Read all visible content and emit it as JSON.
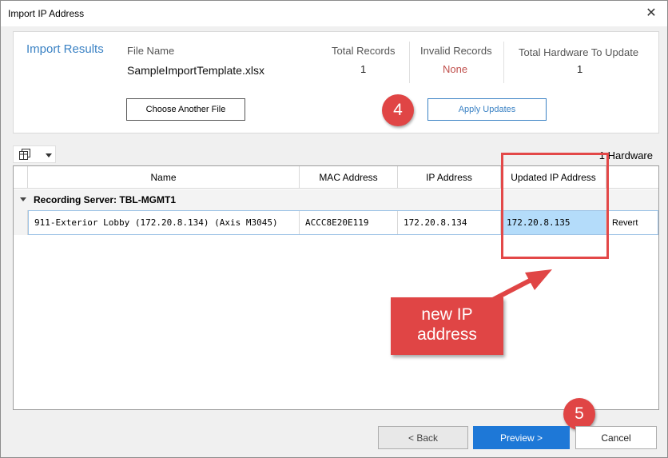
{
  "window": {
    "title": "Import IP Address",
    "close_icon": "close-icon"
  },
  "results": {
    "heading": "Import Results",
    "file_name_label": "File Name",
    "file_name": "SampleImportTemplate.xlsx",
    "total_records_label": "Total Records",
    "total_records": "1",
    "invalid_records_label": "Invalid Records",
    "invalid_records": "None",
    "total_hardware_label": "Total Hardware To Update",
    "total_hardware": "1",
    "choose_file_button": "Choose Another File",
    "apply_updates_button": "Apply Updates"
  },
  "toolbar": {
    "columns_icon": "column-chooser-icon",
    "hardware_count_label": "1 Hardware"
  },
  "grid": {
    "columns": [
      "Name",
      "MAC Address",
      "IP Address",
      "Updated IP Address"
    ],
    "group": {
      "label": "Recording Server: TBL-MGMT1"
    },
    "rows": [
      {
        "name": "911-Exterior Lobby (172.20.8.134) (Axis M3045)",
        "mac": "ACCC8E20E119",
        "ip": "172.20.8.134",
        "updated_ip": "172.20.8.135",
        "action": "Revert"
      }
    ]
  },
  "annotations": {
    "step4": "4",
    "step5": "5",
    "callout_text": "new IP address",
    "color": "#e04545"
  },
  "footer": {
    "back_label": "<    Back",
    "preview_label": "Preview    >",
    "cancel_label": "Cancel"
  },
  "colors": {
    "accent": "#3b82c4",
    "primary_button": "#1e78d7",
    "highlight_cell": "#b4dcfa",
    "invalid_value": "#c0504d"
  }
}
